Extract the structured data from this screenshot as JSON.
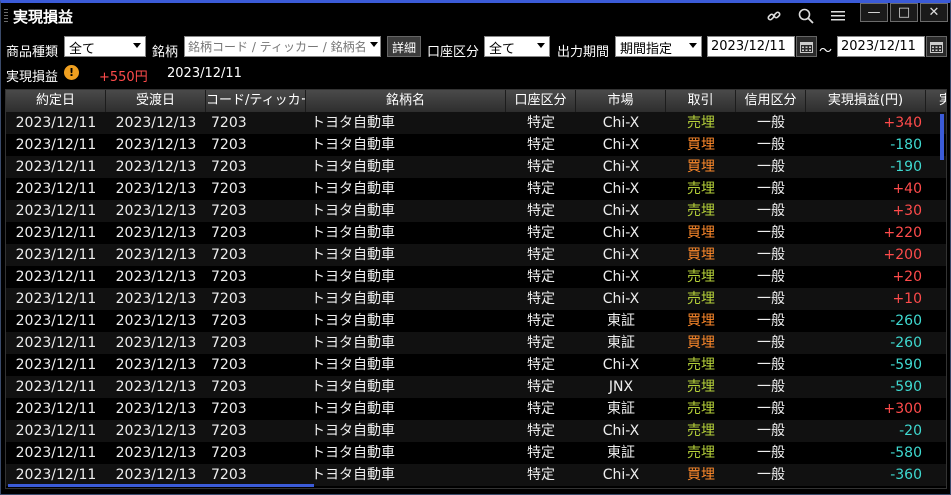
{
  "window": {
    "title": "実現損益"
  },
  "toolbar": {
    "link_icon": "link-icon",
    "search_icon": "search-icon",
    "menu_icon": "menu-icon",
    "minimize": "—",
    "maximize": "□",
    "close": "✕"
  },
  "filters": {
    "product_label": "商品種類",
    "product_value": "全て",
    "issue_label": "銘柄",
    "issue_placeholder": "銘柄コード / ティッカー / 銘柄名",
    "detail_button": "詳細",
    "account_label": "口座区分",
    "account_value": "全て",
    "period_label": "出力期間",
    "period_value": "期間指定",
    "date_from": "2023/12/11",
    "tilde": "～",
    "date_to": "2023/12/11"
  },
  "summary": {
    "label": "実現損益",
    "warn": "!",
    "amount": "+550円",
    "date": "2023/12/11",
    "amount_color": "#ff4b4b"
  },
  "table": {
    "headers": [
      "約定日",
      "受渡日",
      "コード/ティッカー",
      "銘柄名",
      "口座区分",
      "市場",
      "取引",
      "信用区分",
      "実現損益(円)",
      "実"
    ],
    "rows": [
      [
        "2023/12/11",
        "2023/12/13",
        "7203",
        "トヨタ自動車",
        "特定",
        "Chi-X",
        "売埋",
        "一般",
        "+340"
      ],
      [
        "2023/12/11",
        "2023/12/13",
        "7203",
        "トヨタ自動車",
        "特定",
        "Chi-X",
        "買埋",
        "一般",
        "-180"
      ],
      [
        "2023/12/11",
        "2023/12/13",
        "7203",
        "トヨタ自動車",
        "特定",
        "Chi-X",
        "買埋",
        "一般",
        "-190"
      ],
      [
        "2023/12/11",
        "2023/12/13",
        "7203",
        "トヨタ自動車",
        "特定",
        "Chi-X",
        "売埋",
        "一般",
        "+40"
      ],
      [
        "2023/12/11",
        "2023/12/13",
        "7203",
        "トヨタ自動車",
        "特定",
        "Chi-X",
        "売埋",
        "一般",
        "+30"
      ],
      [
        "2023/12/11",
        "2023/12/13",
        "7203",
        "トヨタ自動車",
        "特定",
        "Chi-X",
        "買埋",
        "一般",
        "+220"
      ],
      [
        "2023/12/11",
        "2023/12/13",
        "7203",
        "トヨタ自動車",
        "特定",
        "Chi-X",
        "買埋",
        "一般",
        "+200"
      ],
      [
        "2023/12/11",
        "2023/12/13",
        "7203",
        "トヨタ自動車",
        "特定",
        "Chi-X",
        "売埋",
        "一般",
        "+20"
      ],
      [
        "2023/12/11",
        "2023/12/13",
        "7203",
        "トヨタ自動車",
        "特定",
        "Chi-X",
        "売埋",
        "一般",
        "+10"
      ],
      [
        "2023/12/11",
        "2023/12/13",
        "7203",
        "トヨタ自動車",
        "特定",
        "東証",
        "買埋",
        "一般",
        "-260"
      ],
      [
        "2023/12/11",
        "2023/12/13",
        "7203",
        "トヨタ自動車",
        "特定",
        "東証",
        "買埋",
        "一般",
        "-260"
      ],
      [
        "2023/12/11",
        "2023/12/13",
        "7203",
        "トヨタ自動車",
        "特定",
        "Chi-X",
        "売埋",
        "一般",
        "-590"
      ],
      [
        "2023/12/11",
        "2023/12/13",
        "7203",
        "トヨタ自動車",
        "特定",
        "JNX",
        "売埋",
        "一般",
        "-590"
      ],
      [
        "2023/12/11",
        "2023/12/13",
        "7203",
        "トヨタ自動車",
        "特定",
        "東証",
        "売埋",
        "一般",
        "+300"
      ],
      [
        "2023/12/11",
        "2023/12/13",
        "7203",
        "トヨタ自動車",
        "特定",
        "Chi-X",
        "売埋",
        "一般",
        "-20"
      ],
      [
        "2023/12/11",
        "2023/12/13",
        "7203",
        "トヨタ自動車",
        "特定",
        "東証",
        "売埋",
        "一般",
        "-580"
      ],
      [
        "2023/12/11",
        "2023/12/13",
        "7203",
        "トヨタ自動車",
        "特定",
        "Chi-X",
        "買埋",
        "一般",
        "-360"
      ]
    ]
  },
  "colors": {
    "accent": "#3b5bd8",
    "profit": "#ff4b4b",
    "loss": "#3fd9d0",
    "sell_close": "#b7d23a",
    "buy_close": "#ff8a2b"
  }
}
